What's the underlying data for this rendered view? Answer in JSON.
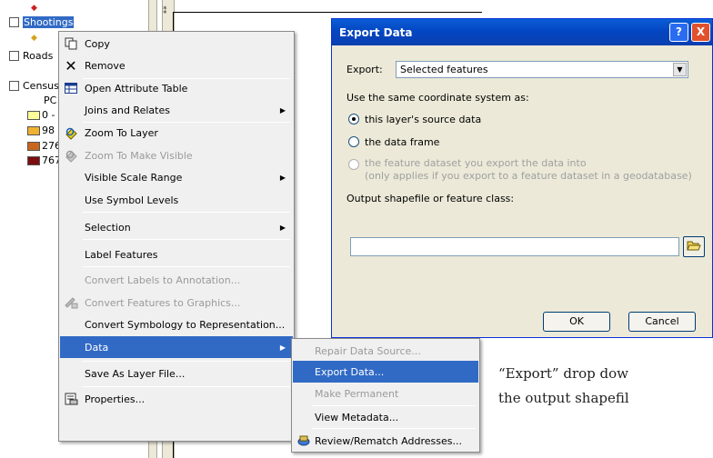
{
  "toc": {
    "layers": [
      {
        "name": "Shootings",
        "checked": false,
        "selected": true
      },
      {
        "name": "Roads",
        "checked": false,
        "selected": false
      },
      {
        "name": "Census",
        "checked": false,
        "selected": false
      }
    ],
    "census_field": "PC",
    "legend": [
      {
        "label": "0 -",
        "color": "#ffff99"
      },
      {
        "label": "98",
        "color": "#f0b030"
      },
      {
        "label": "276",
        "color": "#c8661e"
      },
      {
        "label": "767",
        "color": "#7b0f0f"
      }
    ],
    "point_symbol_color": "#cc2020",
    "point_symbol2_color": "#d4a21c"
  },
  "context_menu": {
    "items": [
      {
        "label": "Copy",
        "icon": "copy-icon",
        "disabled": false,
        "submenu": false
      },
      {
        "label": "Remove",
        "icon": "remove-icon",
        "disabled": false,
        "submenu": false
      },
      {
        "label": "Open Attribute Table",
        "icon": "table-icon",
        "disabled": false,
        "submenu": false
      },
      {
        "label": "Joins and Relates",
        "icon": "",
        "disabled": false,
        "submenu": true
      },
      {
        "label": "Zoom To Layer",
        "icon": "zoom-layer-icon",
        "disabled": false,
        "submenu": false
      },
      {
        "label": "Zoom To Make Visible",
        "icon": "zoom-visible-icon",
        "disabled": true,
        "submenu": false
      },
      {
        "label": "Visible Scale Range",
        "icon": "",
        "disabled": false,
        "submenu": true
      },
      {
        "label": "Use Symbol Levels",
        "icon": "",
        "disabled": false,
        "submenu": false
      },
      {
        "label": "Selection",
        "icon": "",
        "disabled": false,
        "submenu": true
      },
      {
        "label": "Label Features",
        "icon": "",
        "disabled": false,
        "submenu": false
      },
      {
        "label": "Convert Labels to Annotation...",
        "icon": "",
        "disabled": true,
        "submenu": false
      },
      {
        "label": "Convert Features to Graphics...",
        "icon": "convert-graphics-icon",
        "disabled": true,
        "submenu": false
      },
      {
        "label": "Convert Symbology to Representation...",
        "icon": "",
        "disabled": false,
        "submenu": false
      },
      {
        "label": "Data",
        "icon": "",
        "disabled": false,
        "submenu": true,
        "highlighted": true
      },
      {
        "label": "Save As Layer File...",
        "icon": "",
        "disabled": false,
        "submenu": false
      },
      {
        "label": "Properties...",
        "icon": "properties-icon",
        "disabled": false,
        "submenu": false
      }
    ]
  },
  "data_submenu": {
    "items": [
      {
        "label": "Repair Data Source...",
        "disabled": true
      },
      {
        "label": "Export Data...",
        "disabled": false,
        "highlighted": true
      },
      {
        "label": "Make Permanent",
        "disabled": true
      },
      {
        "label": "View Metadata...",
        "disabled": false
      },
      {
        "label": "Review/Rematch Addresses...",
        "disabled": false,
        "icon": "rematch-icon"
      }
    ]
  },
  "dialog": {
    "title": "Export Data",
    "help_label": "?",
    "close_label": "X",
    "export_label": "Export:",
    "export_value": "Selected features",
    "coord_label": "Use the same coordinate system as:",
    "radio_source": "this layer's source data",
    "radio_frame": "the data frame",
    "radio_dataset_line1": "the feature dataset you export the data into",
    "radio_dataset_line2": "(only applies if you export to a feature dataset in a geodatabase)",
    "output_label": "Output shapefile or feature class:",
    "output_value": "",
    "ok_label": "OK",
    "cancel_label": "Cancel"
  },
  "caption": {
    "line1": "“Export” drop dow",
    "line2": "the output shapefil"
  }
}
